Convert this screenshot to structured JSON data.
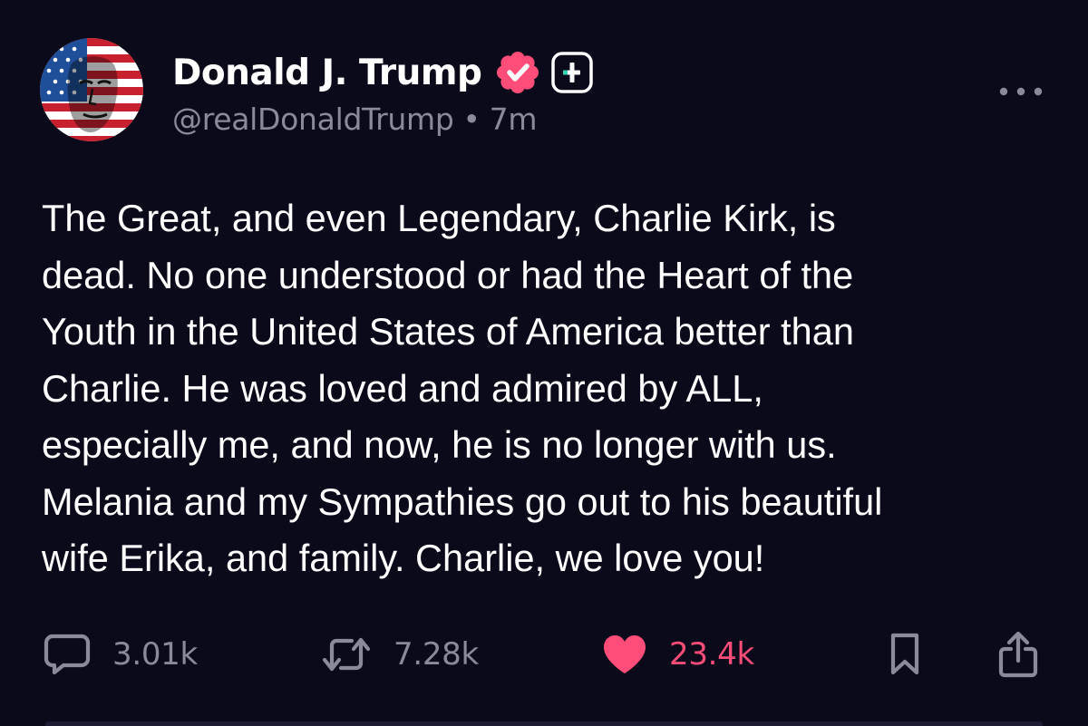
{
  "author": {
    "display_name": "Donald J. Trump",
    "handle": "@realDonaldTrump",
    "separator": "•",
    "time": "7m",
    "verified_badge_color": "#ff4d79",
    "icons": {
      "avatar": "avatar-image",
      "verified": "verified-badge-icon",
      "add": "plus-icon",
      "more": "ellipsis-icon"
    }
  },
  "post": {
    "lines": [
      "The Great, and even Legendary, Charlie Kirk, is",
      "dead. No one understood or had the Heart of the",
      "Youth in the United States of America better than",
      "Charlie. He was loved and admired by ALL,",
      "especially me, and now, he is no longer with us.",
      "Melania and my Sympathies go out to his beautiful",
      "wife Erika, and family. Charlie, we love you!"
    ]
  },
  "actions": {
    "replies": {
      "count": "3.01k",
      "icon": "reply-bubble-icon"
    },
    "reposts": {
      "count": "7.28k",
      "icon": "repost-icon"
    },
    "likes": {
      "count": "23.4k",
      "icon": "heart-icon",
      "liked": true,
      "color": "#ff4d79"
    },
    "bookmark": {
      "icon": "bookmark-icon"
    },
    "share": {
      "icon": "share-icon"
    }
  },
  "theme": {
    "background": "#0b0a1a",
    "text": "#ffffff",
    "muted": "#8b8a9c",
    "accent": "#ff4d79"
  }
}
